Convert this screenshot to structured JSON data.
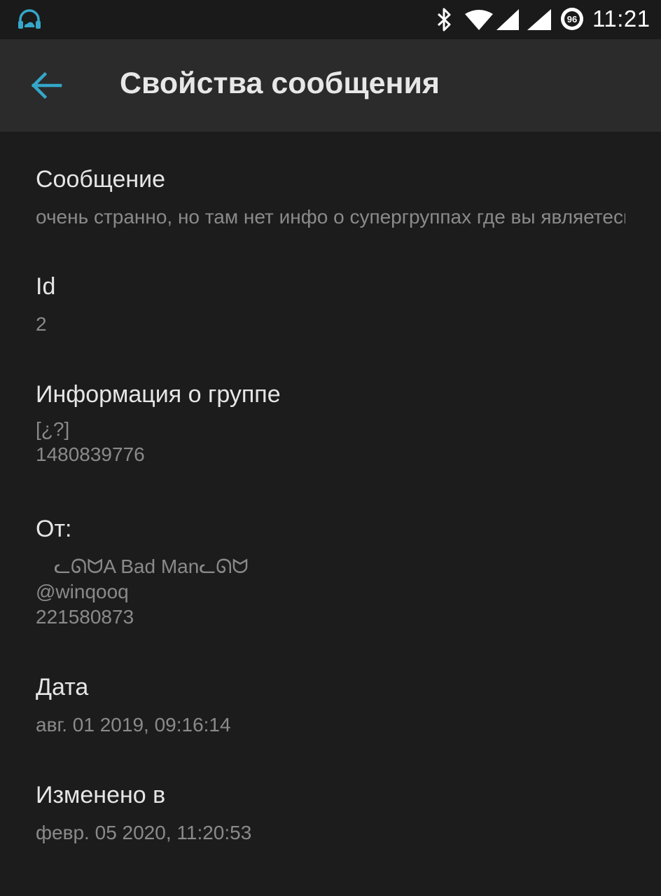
{
  "status_bar": {
    "time": "11:21",
    "battery_level": "96",
    "icons": [
      "headphones-cloud-icon",
      "bluetooth-icon",
      "wifi-icon",
      "signal-icon",
      "signal-icon",
      "battery-icon"
    ],
    "accent_color": "#35a7c9"
  },
  "toolbar": {
    "back_icon": "arrow-left-icon",
    "title": "Свойства сообщения"
  },
  "fields": {
    "message": {
      "label": "Сообщение",
      "value": "очень странно, но там нет инфо о супергруппах где вы являетесь"
    },
    "id": {
      "label": "Id",
      "value": "2"
    },
    "group": {
      "label": "Информация о группе",
      "line1": "[¿?]",
      "line2": "1480839776"
    },
    "from": {
      "label": "От:",
      "name": "ᓚᘏᗢA Bad Manᓚᘏᗢ",
      "username": "@winqooq",
      "user_id": "221580873"
    },
    "date": {
      "label": "Дата",
      "value": "авг. 01 2019, 09:16:14"
    },
    "edited": {
      "label": "Изменено в",
      "value": "февр. 05 2020, 11:20:53"
    }
  }
}
